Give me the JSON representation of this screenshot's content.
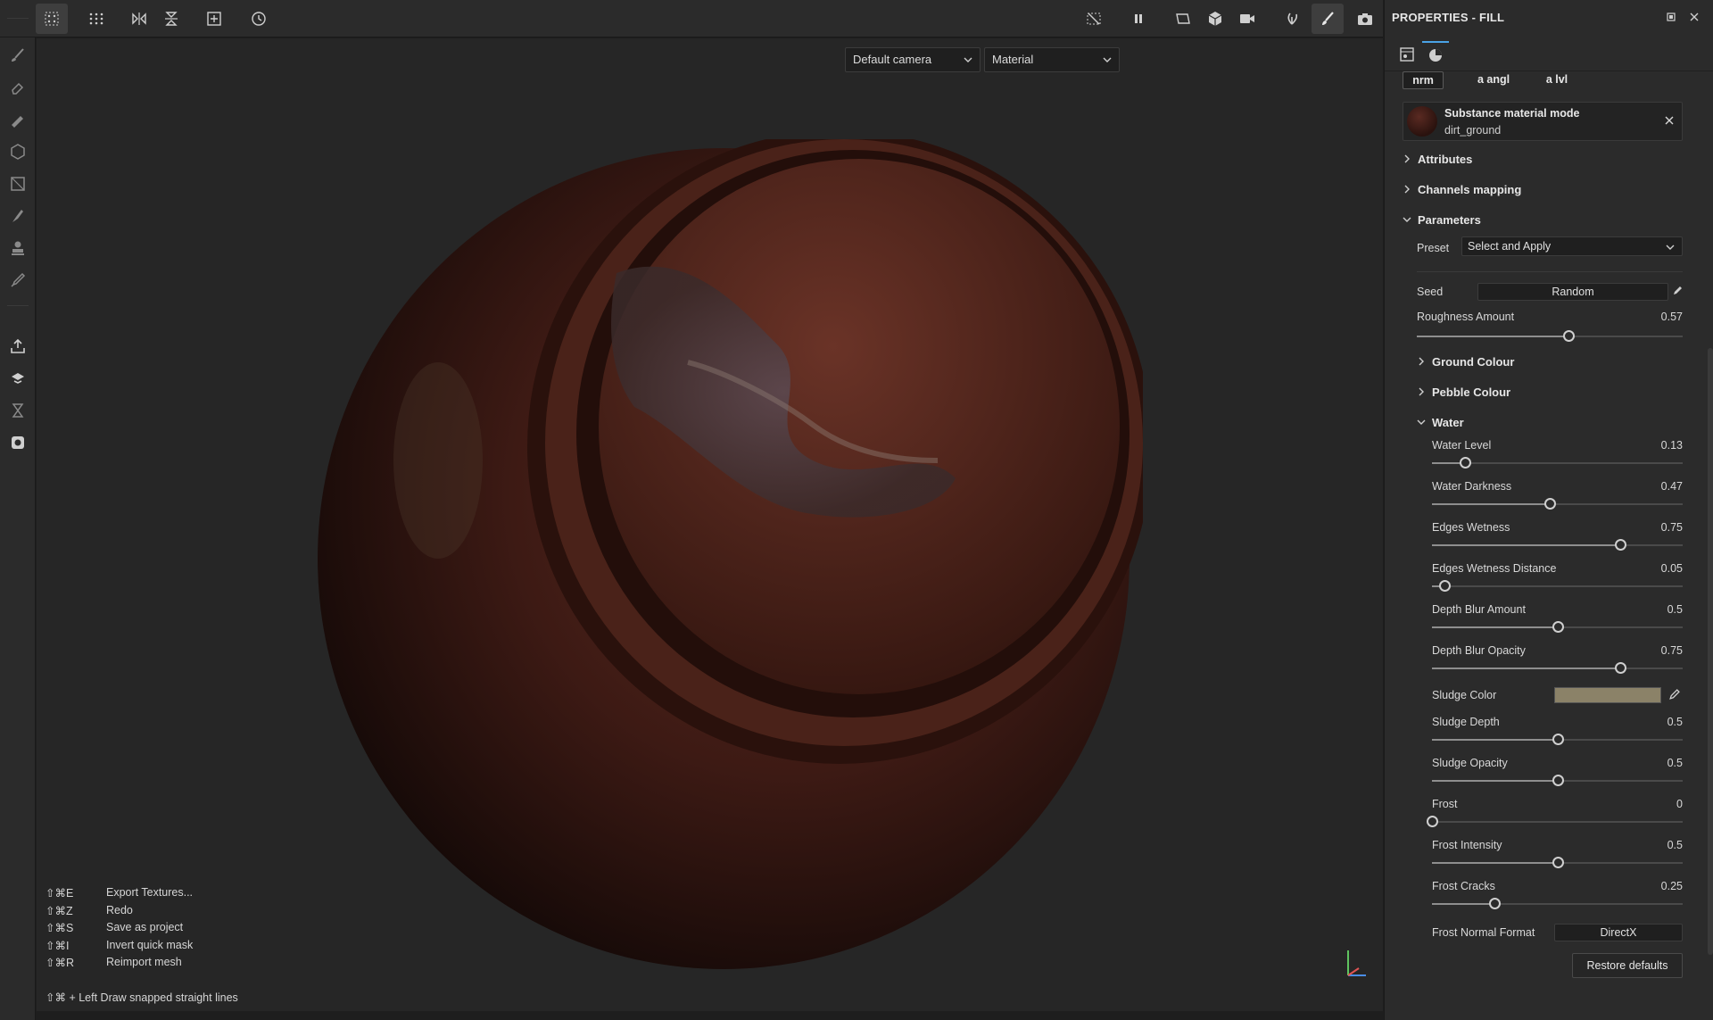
{
  "toolbar": {
    "left_icons": [
      "grid-select-icon",
      "grid-dots-icon",
      "mirror-x-icon",
      "mirror-y-icon",
      "add-square-icon",
      "history-icon"
    ],
    "right_icons": [
      "hide-icon",
      "pause-icon",
      "frame-icon",
      "cube-icon",
      "camera-icon",
      "splash-icon",
      "brush-icon",
      "screenshot-icon"
    ]
  },
  "viewport": {
    "camera_select": "Default camera",
    "mode_select": "Material",
    "shortcuts": [
      {
        "key": "⇧⌘E",
        "action": "Export Textures..."
      },
      {
        "key": "⇧⌘Z",
        "action": "Redo"
      },
      {
        "key": "⇧⌘S",
        "action": "Save as project"
      },
      {
        "key": "⇧⌘I",
        "action": "Invert quick mask"
      },
      {
        "key": "⇧⌘R",
        "action": "Reimport mesh"
      }
    ],
    "hint": "⇧⌘ + Left  Draw snapped straight lines"
  },
  "panel": {
    "title": "PROPERTIES - FILL",
    "channels": [
      "nrm",
      "a angl",
      "a lvl"
    ],
    "material": {
      "title": "Substance material mode",
      "name": "dirt_ground"
    },
    "sections": {
      "attributes": "Attributes",
      "channels_mapping": "Channels mapping",
      "parameters": "Parameters",
      "ground_colour": "Ground Colour",
      "pebble_colour": "Pebble Colour",
      "water": "Water"
    },
    "preset": {
      "label": "Preset",
      "value": "Select and Apply"
    },
    "seed": {
      "label": "Seed",
      "value": "Random"
    },
    "roughness": {
      "label": "Roughness Amount",
      "value": "0.57",
      "fraction": 0.57
    },
    "water_params": [
      {
        "label": "Water Level",
        "value": "0.13",
        "fraction": 0.13
      },
      {
        "label": "Water Darkness",
        "value": "0.47",
        "fraction": 0.47
      },
      {
        "label": "Edges Wetness",
        "value": "0.75",
        "fraction": 0.75
      },
      {
        "label": "Edges Wetness Distance",
        "value": "0.05",
        "fraction": 0.05
      },
      {
        "label": "Depth Blur Amount",
        "value": "0.5",
        "fraction": 0.5
      },
      {
        "label": "Depth Blur Opacity",
        "value": "0.75",
        "fraction": 0.75
      }
    ],
    "sludge_color": {
      "label": "Sludge Color",
      "color": "#8b8268"
    },
    "water_params2": [
      {
        "label": "Sludge Depth",
        "value": "0.5",
        "fraction": 0.5
      },
      {
        "label": "Sludge Opacity",
        "value": "0.5",
        "fraction": 0.5
      },
      {
        "label": "Frost",
        "value": "0",
        "fraction": 0
      },
      {
        "label": "Frost Intensity",
        "value": "0.5",
        "fraction": 0.5
      },
      {
        "label": "Frost Cracks",
        "value": "0.25",
        "fraction": 0.25
      }
    ],
    "normal_format": {
      "label": "Frost Normal Format",
      "value": "DirectX"
    },
    "restore_button": "Restore defaults"
  },
  "colors": {
    "accent": "#4aa3e6",
    "panel_bg": "#2b2b2b",
    "viewport_bg": "#262626"
  }
}
